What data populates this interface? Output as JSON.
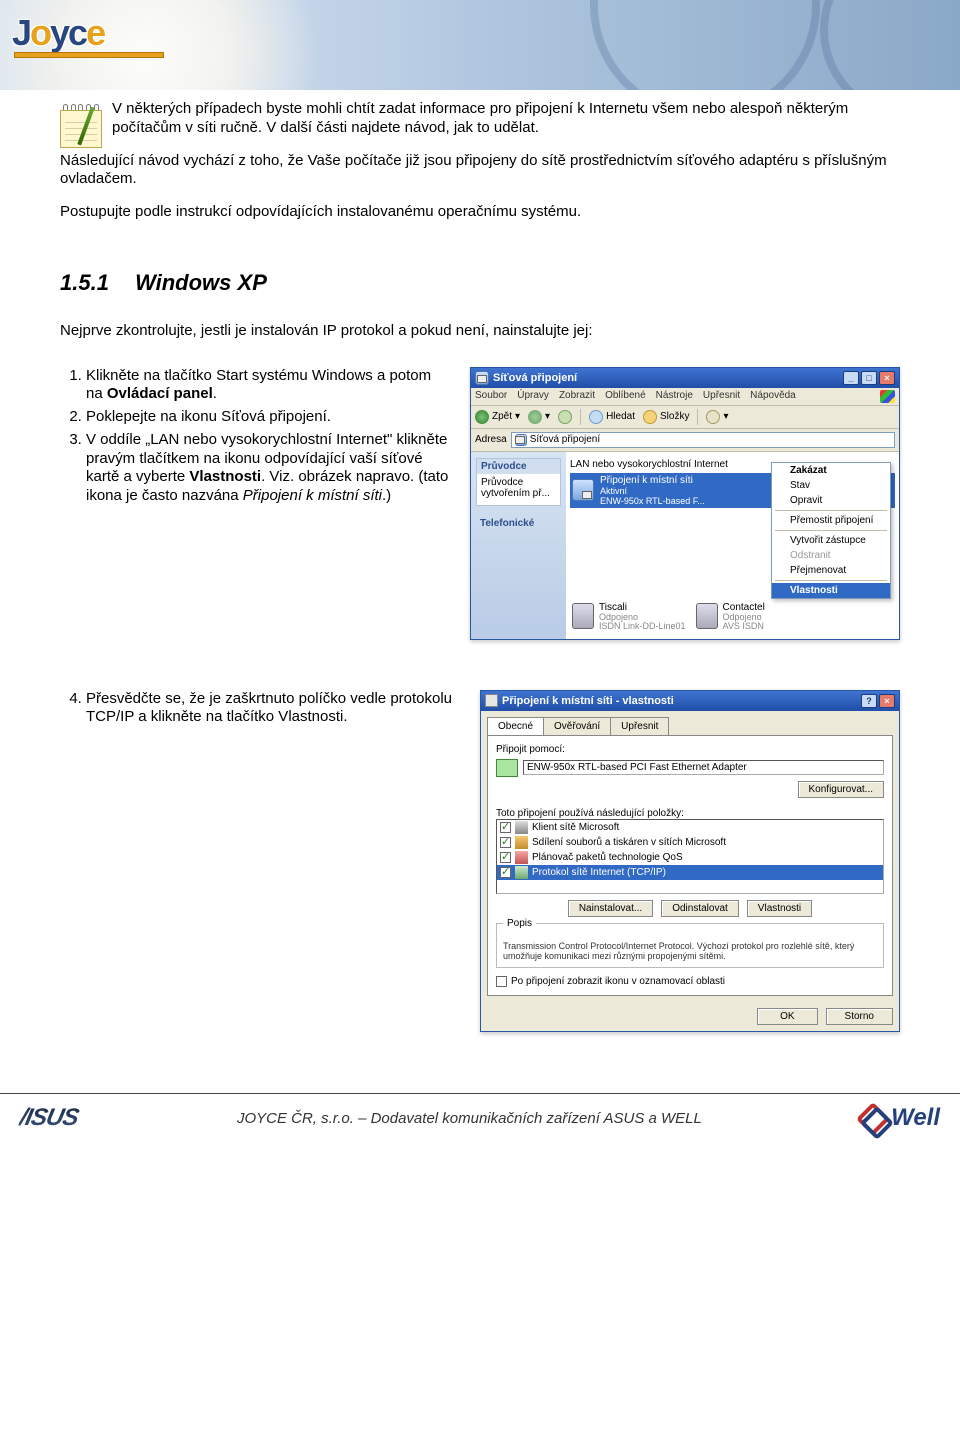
{
  "header": {
    "logo_text": "Joyce"
  },
  "note": "V některých případech byste mohli chtít zadat informace pro připojení k Internetu všem nebo alespoň některým počítačům v síti ručně. V další části najdete návod, jak to udělat.",
  "para2": "Následující návod vychází z toho, že Vaše počítače již jsou připojeny do sítě prostřednictvím síťového adaptéru s příslušným ovladačem.",
  "para3": "Postupujte podle instrukcí odpovídajících instalovanému operačnímu systému.",
  "section": {
    "number": "1.5.1",
    "title": "Windows XP"
  },
  "intro": "Nejprve zkontrolujte, jestli je instalován IP protokol a pokud není, nainstalujte jej:",
  "steps": {
    "s1a": "Klikněte na tlačítko Start systému Windows a potom na ",
    "s1b": "Ovládací panel",
    "s1c": ".",
    "s2": "Poklepejte na ikonu Síťová připojení.",
    "s3a": "V oddíle „LAN nebo vysokorychlostní Internet\" klikněte pravým tlačítkem na ikonu odpovídající vaší síťové kartě a vyberte ",
    "s3b": "Vlastnosti",
    "s3c": ". Viz. obrázek napravo. (tato ikona je často nazvána ",
    "s3d": "Připojení k místní síti",
    "s3e": ".)",
    "s4": "Přesvědčte se, že je zaškrtnuto políčko vedle protokolu TCP/IP a klikněte na tlačítko Vlastnosti."
  },
  "win1": {
    "title": "Síťová připojení",
    "menu": [
      "Soubor",
      "Úpravy",
      "Zobrazit",
      "Oblíbené",
      "Nástroje",
      "Upřesnit",
      "Nápověda"
    ],
    "tb_back": "Zpět",
    "tb_search": "Hledat",
    "tb_folders": "Složky",
    "addr_label": "Adresa",
    "addr_value": "Síťová připojení",
    "section_lan": "LAN nebo vysokorychlostní Internet",
    "conn_name": "Připojení k místní síti",
    "conn_status": "Aktivní",
    "conn_adapter": "ENW-950x RTL-based F...",
    "side_group1": "Průvodce",
    "side_item1": "Průvodce vytvořením př...",
    "side_group2": "Telefonické",
    "phone1_name": "Tiscali",
    "phone1_status": "Odpojeno",
    "phone1_dev": "ISDN Link-DD-Line01",
    "phone2_name": "Contactel",
    "phone2_status": "Odpojeno",
    "phone2_dev": "AVS ISDN",
    "ctx": {
      "disable": "Zakázat",
      "status": "Stav",
      "repair": "Opravit",
      "bridge": "Přemostit připojení",
      "shortcut": "Vytvořit zástupce",
      "delete": "Odstranit",
      "rename": "Přejmenovat",
      "properties": "Vlastnosti"
    }
  },
  "win2": {
    "title": "Připojení k místní síti - vlastnosti",
    "tabs": [
      "Obecné",
      "Ověřování",
      "Upřesnit"
    ],
    "connect_using": "Připojit pomocí:",
    "adapter": "ENW-950x RTL-based PCI Fast Ethernet Adapter",
    "configure": "Konfigurovat...",
    "uses_items": "Toto připojení používá následující položky:",
    "items": [
      "Klient sítě Microsoft",
      "Sdílení souborů a tiskáren v sítích Microsoft",
      "Plánovač paketů technologie QoS",
      "Protokol sítě Internet (TCP/IP)"
    ],
    "install": "Nainstalovat...",
    "uninstall": "Odinstalovat",
    "properties": "Vlastnosti",
    "desc_label": "Popis",
    "desc_text": "Transmission Control Protocol/Internet Protocol. Výchozí protokol pro rozlehlé sítě, který umožňuje komunikaci mezi různými propojenými sítěmi.",
    "show_icon": "Po připojení zobrazit ikonu v oznamovací oblasti",
    "ok": "OK",
    "cancel": "Storno"
  },
  "footer": {
    "asus": "/ISUS",
    "text": "JOYCE ČR, s.r.o. – Dodavatel komunikačních zařízení ASUS a WELL",
    "well": "Well"
  }
}
